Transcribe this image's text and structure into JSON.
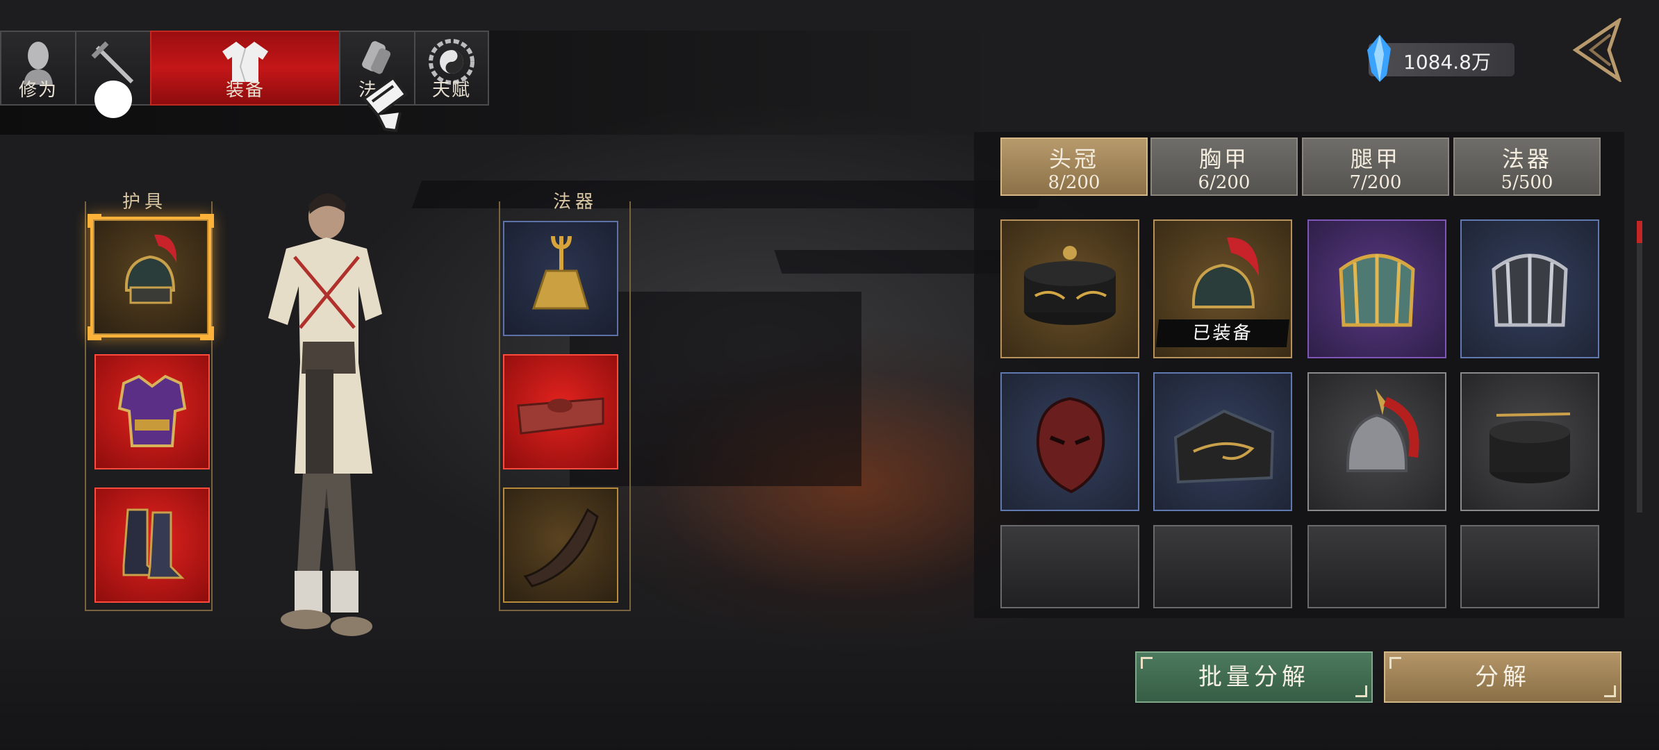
{
  "nav": {
    "tabs": [
      {
        "label": "修为",
        "icon": "cultivator-head-icon"
      },
      {
        "label": "",
        "icon": "sword-icon"
      },
      {
        "label": "装备",
        "icon": "robe-icon",
        "active": true
      },
      {
        "label": "法",
        "icon": "scroll-icon"
      },
      {
        "label": "天赋",
        "icon": "bagua-icon"
      }
    ]
  },
  "currency": {
    "icon": "spirit-crystal-icon",
    "value": "1084.8万"
  },
  "back_icon": "back-arrow-icon",
  "equip": {
    "armor_title": "护具",
    "artifact_title": "法器",
    "armor_slots": [
      {
        "name": "helmet",
        "rarity": "gold",
        "selected": true,
        "icon": "plumed-helmet-icon"
      },
      {
        "name": "chest",
        "rarity": "red",
        "icon": "chest-armor-icon"
      },
      {
        "name": "boots",
        "rarity": "red",
        "icon": "boots-icon"
      }
    ],
    "artifact_slots": [
      {
        "name": "bell",
        "rarity": "blue",
        "icon": "bell-icon"
      },
      {
        "name": "box",
        "rarity": "red",
        "icon": "carved-box-icon"
      },
      {
        "name": "horn",
        "rarity": "gold",
        "icon": "horn-icon"
      }
    ]
  },
  "inventory": {
    "categories": [
      {
        "name": "头冠",
        "count": "8/200",
        "active": true
      },
      {
        "name": "胸甲",
        "count": "6/200"
      },
      {
        "name": "腿甲",
        "count": "7/200"
      },
      {
        "name": "法器",
        "count": "5/500"
      }
    ],
    "equipped_label": "已装备",
    "items": [
      {
        "rarity": "gold",
        "icon": "black-cap-icon"
      },
      {
        "rarity": "gold",
        "icon": "plumed-helmet-icon",
        "equipped": true
      },
      {
        "rarity": "purple",
        "icon": "crown-icon"
      },
      {
        "rarity": "blue",
        "icon": "silver-crown-icon"
      },
      {
        "rarity": "blue",
        "icon": "demon-mask-icon"
      },
      {
        "rarity": "blue",
        "icon": "scholar-hat-icon"
      },
      {
        "rarity": "grey",
        "icon": "steel-helmet-icon"
      },
      {
        "rarity": "grey",
        "icon": "plain-cap-icon"
      }
    ]
  },
  "buttons": {
    "batch_decompose": "批量分解",
    "decompose": "分解"
  },
  "colors": {
    "active_tab": "#c41618",
    "gold": "#b8925a",
    "red": "#e3231f",
    "blue": "#6079b0",
    "purple": "#7e56b8",
    "green_btn": "#4c7a5e",
    "tan_btn": "#b39567"
  }
}
